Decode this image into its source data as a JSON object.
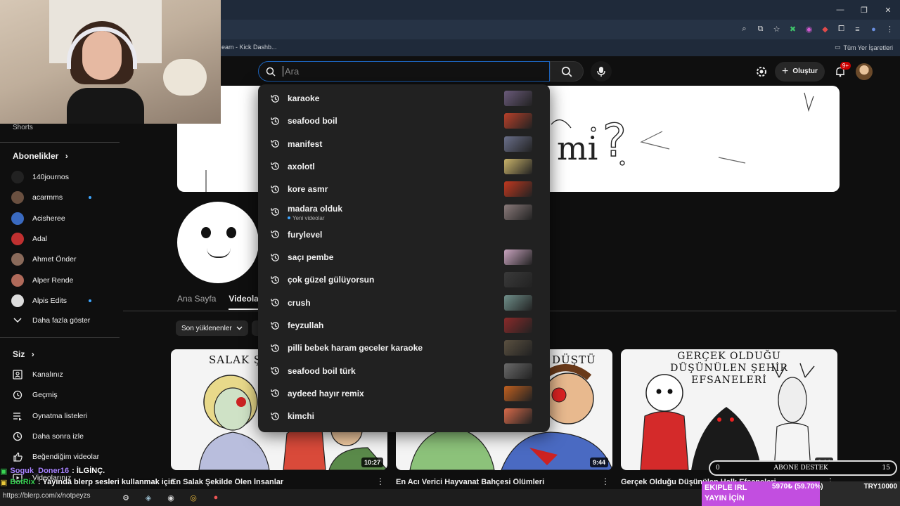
{
  "browser": {
    "bookmark_left": "eam - Kick Dashb...",
    "bookmark_right": "Tüm Yer İşaretleri"
  },
  "header": {
    "search_placeholder": "Ara",
    "create_label": "Oluştur",
    "notification_count": "9+"
  },
  "suggestions": [
    {
      "text": "karaoke",
      "thumb": "#6a5a7a"
    },
    {
      "text": "seafood boil",
      "thumb": "#b8402a"
    },
    {
      "text": "manifest",
      "thumb": "#6a6f8a"
    },
    {
      "text": "axolotl",
      "thumb": "#c9b36a"
    },
    {
      "text": "kore asmr",
      "thumb": "#c0381f"
    },
    {
      "text": "madara olduk",
      "sub": "Yeni videolar",
      "thumb": "#8a7a7a"
    },
    {
      "text": "furylevel"
    },
    {
      "text": "saçı pembe",
      "thumb": "#c9a4bf"
    },
    {
      "text": "çok güzel gülüyorsun",
      "thumb": "#3a3a3a"
    },
    {
      "text": "crush",
      "thumb": "#6f8f8a"
    },
    {
      "text": "feyzullah",
      "thumb": "#8a2a2a"
    },
    {
      "text": "pilli bebek haram geceler karaoke",
      "thumb": "#5a5040"
    },
    {
      "text": "seafood boil türk",
      "thumb": "#6a6a6a"
    },
    {
      "text": "aydeed hayır remix",
      "thumb": "#c06020"
    },
    {
      "text": "kimchi",
      "thumb": "#d86a4a"
    }
  ],
  "sidebar": {
    "cut_text": "Shorts",
    "subs_title": "Abonelikler",
    "subscriptions": [
      {
        "name": "140journos",
        "dot": false
      },
      {
        "name": "acarmms",
        "dot": true
      },
      {
        "name": "Acisheree",
        "dot": false
      },
      {
        "name": "Adal",
        "dot": false
      },
      {
        "name": "Ahmet Önder",
        "dot": false
      },
      {
        "name": "Alper Rende",
        "dot": false
      },
      {
        "name": "Alpis Edits",
        "dot": true
      }
    ],
    "show_more": "Daha fazla göster",
    "you_title": "Siz",
    "you_items": [
      "Kanalınız",
      "Geçmiş",
      "Oynatma listeleri",
      "Daha sonra izle",
      "Beğendiğim videolar",
      "Videolarınız"
    ]
  },
  "channel": {
    "tabs": [
      "Ana Sayfa",
      "Videolar"
    ],
    "sort_chip": "Son yüklenenler"
  },
  "videos": [
    {
      "thumb_title": "SALAK ŞEKİ",
      "title": "En Salak Şekilde Ölen İnsanlar",
      "duration": "10:27"
    },
    {
      "thumb_title": "DÜŞTÜ",
      "title": "En Acı Verici Hayvanat Bahçesi Ölümleri",
      "duration": "9:44"
    },
    {
      "thumb_title": "GERÇEK OLDUĞU DÜŞÜNÜLEN ŞEHİR EFSANELERİ",
      "title": "Gerçek Olduğu Düşünülen Halk Efsaneleri",
      "duration": "8:14"
    }
  ],
  "overlay": {
    "chat": [
      {
        "user": "Soguk_Doner16",
        "message": ": İLGİNÇ."
      },
      {
        "user": "BotRix",
        "message": ": Yayında blerp sesleri kullanmak için"
      }
    ],
    "url": "https://blerp.com/x/notpeyzs",
    "support_bar": {
      "left": "0",
      "center": "ABONE DESTEK",
      "right": "15"
    },
    "goal": {
      "name_line1": "EKIPLE IRL",
      "name_line2": "YAYIN İÇİN",
      "amount": "5970₺ (59.70%)",
      "target": "TRY10000",
      "progress": 0.597
    }
  }
}
